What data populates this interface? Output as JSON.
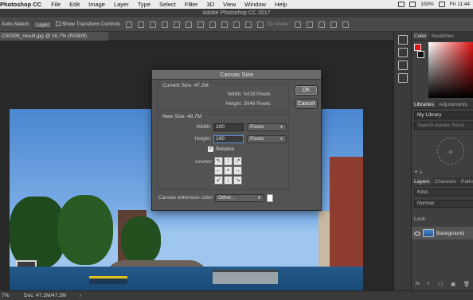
{
  "menubar": {
    "app": "Photoshop CC",
    "items": [
      "File",
      "Edit",
      "Image",
      "Layer",
      "Type",
      "Select",
      "Filter",
      "3D",
      "View",
      "Window",
      "Help"
    ],
    "battery": "100%",
    "clock": "Fri 11:44"
  },
  "window": {
    "title": "Adobe Photoshop CC 2017"
  },
  "options": {
    "auto_select_label": "Auto-Select:",
    "auto_select_value": "Layer",
    "transform_label": "Show Transform Controls",
    "mode_3d": "3D Mode:"
  },
  "document": {
    "tab": "C00399_result.jpg @ 16.7% (RGB/8)"
  },
  "status": {
    "zoom": "7%",
    "doc": "Doc: 47.2M/47.2M"
  },
  "dialog": {
    "title": "Canvas Size",
    "current_label": "Current Size: 47.2M",
    "current_width_label": "Width:",
    "current_width_value": "5418 Pixels",
    "current_height_label": "Height:",
    "current_height_value": "3048 Pixels",
    "new_label": "New Size: 49.7M",
    "width_label": "Width:",
    "width_value": "100",
    "width_unit": "Pixels",
    "height_label": "Height:",
    "height_value": "100",
    "height_unit": "Pixels",
    "relative_label": "Relative",
    "anchor_label": "Anchor:",
    "anchor_cells": [
      "↖",
      "↑",
      "↗",
      "←",
      "•",
      "→",
      "↙",
      "↓",
      "↘"
    ],
    "extension_label": "Canvas extension color:",
    "extension_value": "Other...",
    "extension_color": "#ffffff",
    "ok": "OK",
    "cancel": "Cancel"
  },
  "panels": {
    "color_tabs": [
      "Color",
      "Swatches"
    ],
    "foreground_color": "#e81010",
    "background_color": "#111111",
    "library_tabs": [
      "Libraries",
      "Adjustments"
    ],
    "library_select": "My Library",
    "library_search": "Search Adobe Stock",
    "layers_tabs": [
      "Layers",
      "Channels",
      "Paths"
    ],
    "layers_kind": "Kind",
    "layers_blend": "Normal",
    "layers_lock": "Lock:",
    "layer_name": "Background",
    "layers_footer": [
      "fx",
      "◐",
      "▢",
      "▣",
      "🗑"
    ]
  }
}
